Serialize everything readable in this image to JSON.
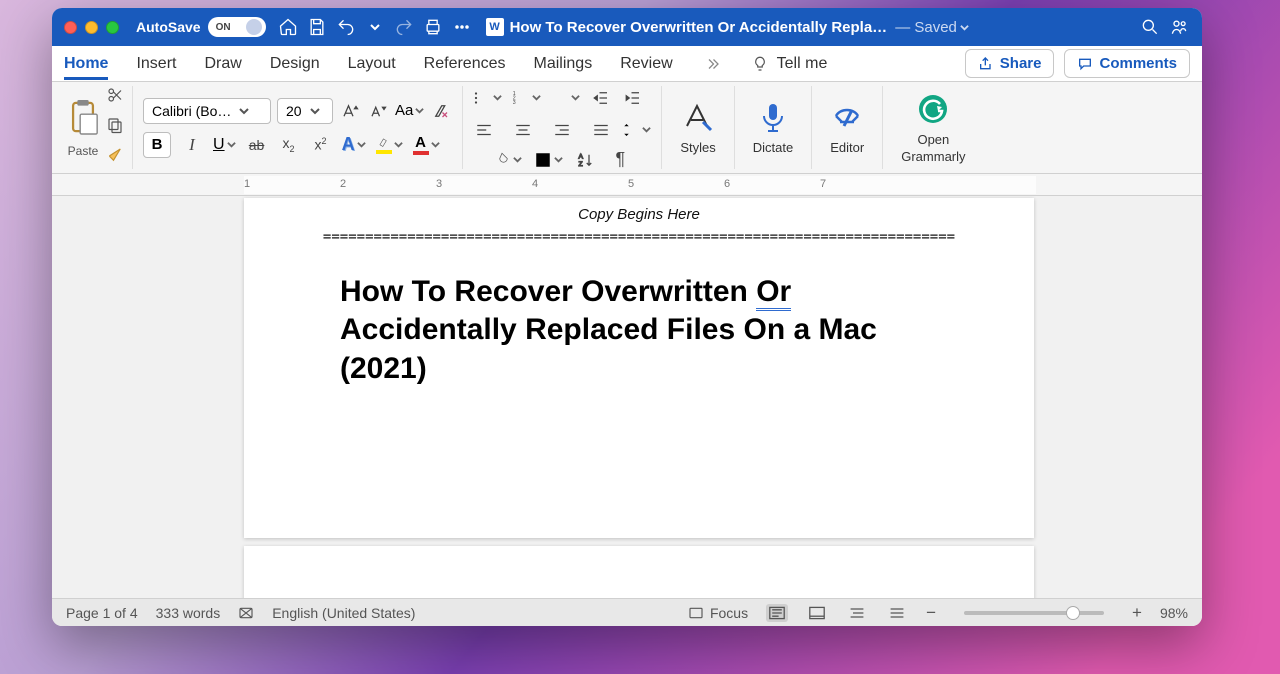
{
  "titlebar": {
    "autosave_label": "AutoSave",
    "autosave_state": "ON",
    "doc_title": "How To Recover Overwritten Or Accidentally Repla…",
    "saved_label": "— Saved"
  },
  "tabs": {
    "items": [
      "Home",
      "Insert",
      "Draw",
      "Design",
      "Layout",
      "References",
      "Mailings",
      "Review"
    ],
    "active": "Home",
    "tellme": "Tell me",
    "share": "Share",
    "comments": "Comments"
  },
  "ribbon": {
    "paste": "Paste",
    "font_name": "Calibri (Bo…",
    "font_size": "20",
    "styles": "Styles",
    "dictate": "Dictate",
    "editor": "Editor",
    "grammarly_l1": "Open",
    "grammarly_l2": "Grammarly"
  },
  "ruler_numbers": [
    "1",
    "2",
    "3",
    "4",
    "5",
    "6",
    "7"
  ],
  "document": {
    "copy_begins": "Copy Begins Here",
    "hr": "===========================================================================",
    "title_part1": "How To Recover Overwritten ",
    "title_or": "Or",
    "title_part2": " Accidentally Replaced Files On a Mac (2021)"
  },
  "status": {
    "page": "Page 1 of 4",
    "words": "333 words",
    "language": "English (United States)",
    "focus": "Focus",
    "zoom": "98%"
  }
}
